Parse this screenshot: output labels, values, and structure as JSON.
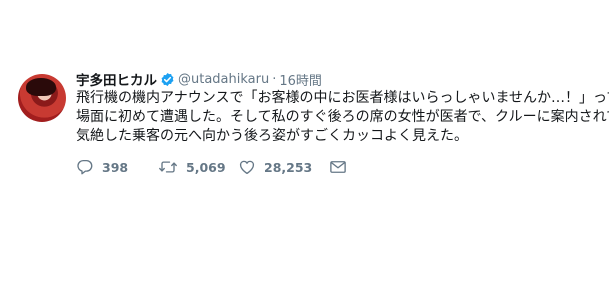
{
  "user": {
    "display_name": "宇多田ヒカル",
    "handle": "@utadahikaru",
    "separator": "·",
    "time": "16時間",
    "verified": true
  },
  "tweet": {
    "text": "飛行機の機内アナウンスで「お客様の中にお医者様はいらっしゃいませんか…！」って場面に初めて遭遇した。そして私のすぐ後ろの席の女性が医者で、クルーに案内されて気絶した乗客の元へ向かう後ろ姿がすごくカッコよく見えた。"
  },
  "actions": {
    "reply_count": "398",
    "retweet_count": "5,069",
    "like_count": "28,253"
  },
  "icons": {
    "avatar": "avatar-image",
    "verified": "verified-badge-icon",
    "reply": "reply-icon",
    "retweet": "retweet-icon",
    "like": "heart-icon",
    "dm": "envelope-icon"
  },
  "colors": {
    "verified": "#1da1f2",
    "muted": "#657786",
    "text": "#14171a"
  }
}
